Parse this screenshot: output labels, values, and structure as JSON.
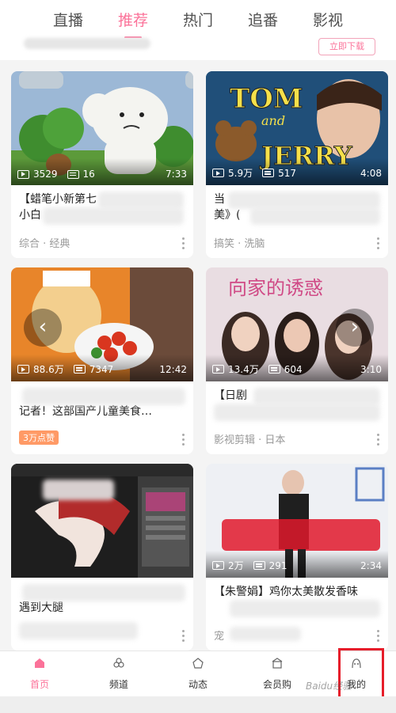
{
  "top_tabs": [
    "直播",
    "推荐",
    "热门",
    "追番",
    "影视"
  ],
  "active_tab": "推荐",
  "prev_card": {
    "download_label": "立即下载"
  },
  "cards": [
    {
      "views": "3529",
      "danmaku": "16",
      "duration": "7:33",
      "title": "【蜡笔小新第七",
      "title2": "小白",
      "tag": "综合 · 经典"
    },
    {
      "views": "5.9万",
      "danmaku": "517",
      "duration": "4:08",
      "title": "当",
      "title2": "美》(",
      "tag": "搞笑 · 洗脑"
    },
    {
      "views": "88.6万",
      "danmaku": "7347",
      "duration": "12:42",
      "title": "",
      "title2": "记者！这部国产儿童美食…",
      "badge": "3万点赞"
    },
    {
      "views": "13.4万",
      "danmaku": "604",
      "duration": "3:10",
      "title": "【日剧",
      "title2": "",
      "tag": "影视剪辑 · 日本"
    },
    {
      "views": "",
      "danmaku": "",
      "duration": "",
      "title": "",
      "title2": "遇到大腿",
      "tag": ""
    },
    {
      "views": "2万",
      "danmaku": "291",
      "duration": "2:34",
      "title": "【朱警娟】鸡你太美散发香味",
      "title2": "",
      "tag": "宠"
    }
  ],
  "thumb_text": {
    "tom": "TOM",
    "and": "and",
    "jerry": "JERRY",
    "drama": "向家的诱惑"
  },
  "bottom_nav": [
    {
      "label": "首页",
      "icon": "home-icon"
    },
    {
      "label": "频道",
      "icon": "channel-icon"
    },
    {
      "label": "动态",
      "icon": "feed-icon"
    },
    {
      "label": "会员购",
      "icon": "shop-icon"
    },
    {
      "label": "我的",
      "icon": "profile-icon"
    }
  ],
  "colors": {
    "accent": "#fb7299",
    "highlight": "#e61d2a",
    "badge": "#ff9a66"
  },
  "watermark": "Baidu经验"
}
